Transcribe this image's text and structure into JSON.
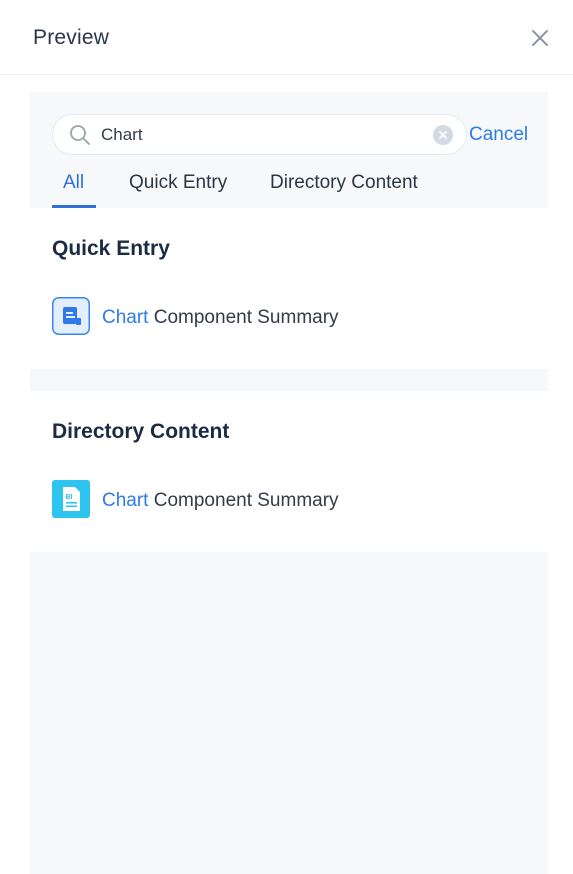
{
  "header": {
    "title": "Preview",
    "close_icon": "close-icon"
  },
  "search": {
    "value": "Chart",
    "placeholder": "",
    "cancel_label": "Cancel",
    "icons": {
      "search": "search-icon",
      "clear": "clear-icon"
    }
  },
  "tabs": [
    {
      "label": "All",
      "active": true
    },
    {
      "label": "Quick Entry",
      "active": false
    },
    {
      "label": "Directory Content",
      "active": false
    }
  ],
  "sections": {
    "quick_entry": {
      "title": "Quick Entry",
      "items": [
        {
          "highlight": "Chart",
          "rest": " Component Summary",
          "icon": "report-icon"
        }
      ]
    },
    "directory_content": {
      "title": "Directory Content",
      "items": [
        {
          "highlight": "Chart",
          "rest": " Component Summary",
          "icon": "bi-document-icon"
        }
      ]
    }
  },
  "colors": {
    "accent": "#2f7be6",
    "tab_active": "#2f6fd6",
    "panel_bg": "#f6f8fa",
    "heading": "#1c2b44"
  }
}
